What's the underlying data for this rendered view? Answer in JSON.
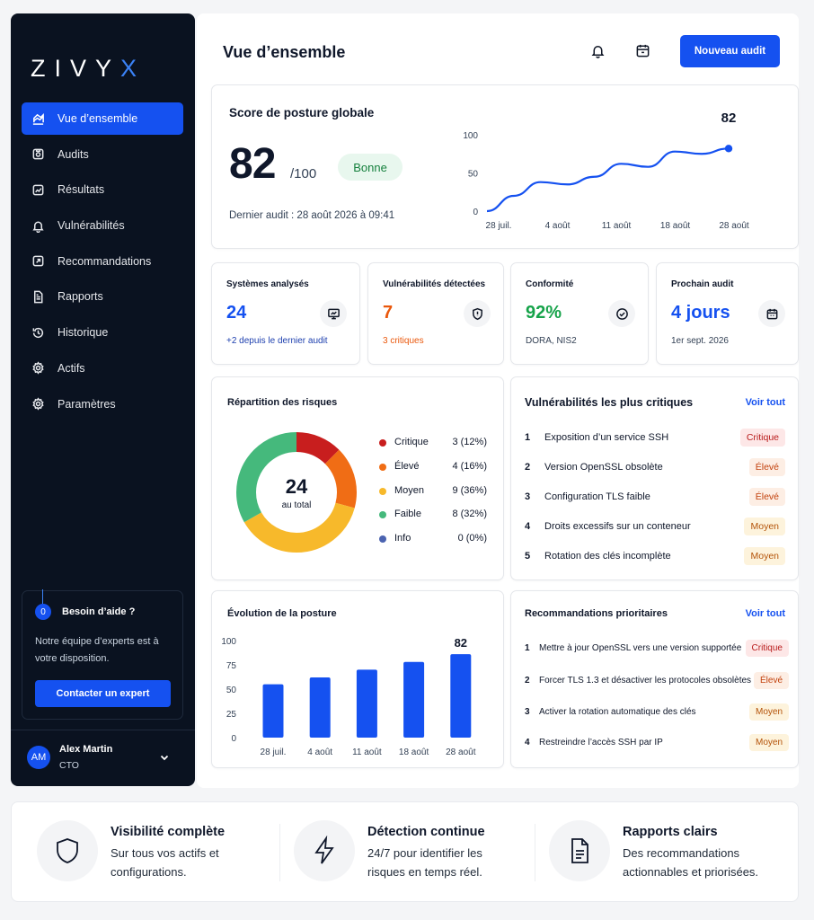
{
  "brand": {
    "logo_text": "ZIVY",
    "logo_accent": "X"
  },
  "sidebar": {
    "items": [
      {
        "label": "Vue d’ensemble",
        "icon": "overview-icon",
        "active": true
      },
      {
        "label": "Audits",
        "icon": "audit-icon"
      },
      {
        "label": "Résultats",
        "icon": "results-icon"
      },
      {
        "label": "Vulnérabilités",
        "icon": "bell-icon"
      },
      {
        "label": "Recommandations",
        "icon": "recommendations-icon"
      },
      {
        "label": "Rapports",
        "icon": "report-icon"
      },
      {
        "label": "Historique",
        "icon": "history-icon"
      },
      {
        "label": "Actifs",
        "icon": "assets-gear-icon"
      },
      {
        "label": "Paramètres",
        "icon": "settings-gear-icon"
      }
    ],
    "help": {
      "badge": "0",
      "title": "Besoin d’aide ?",
      "text": "Notre équipe d’experts est à votre disposition.",
      "button": "Contacter un expert"
    },
    "user": {
      "initials": "AM",
      "name": "Alex Martin",
      "role": "CTO"
    }
  },
  "header": {
    "title": "Vue d’ensemble",
    "new_audit_button": "Nouveau audit",
    "icons": [
      "bell-icon",
      "calendar-icon"
    ]
  },
  "score": {
    "title": "Score de posture globale",
    "value": "82",
    "max": "/100",
    "badge": "Bonne",
    "last_audit": "Dernier audit : 28 août 2026 à 09:41",
    "end_label": "82"
  },
  "kpis": [
    {
      "label": "Systèmes analysés",
      "value": "24",
      "sub": "+2 depuis le dernier audit",
      "value_color": "#1551f0",
      "sub_color": "#1e40af",
      "icon": "monitor-icon"
    },
    {
      "label": "Vulnérabilités détectées",
      "value": "7",
      "sub": "3 critiques",
      "value_color": "#ea580c",
      "sub_color": "#ea580c",
      "icon": "shield-alert-icon"
    },
    {
      "label": "Conformité",
      "value": "92%",
      "sub": "DORA, NIS2",
      "value_color": "#16a34a",
      "sub_color": "#334155",
      "icon": "check-circle-icon"
    },
    {
      "label": "Prochain audit",
      "value": "4 jours",
      "sub": "1er sept. 2026",
      "value_color": "#1551f0",
      "sub_color": "#334155",
      "icon": "calendar-icon"
    }
  ],
  "risks": {
    "title": "Répartition des risques",
    "total": "24",
    "total_label": "au total",
    "items": [
      {
        "label": "Critique",
        "value": "3 (12%)",
        "count": 3,
        "color": "#c81e1e"
      },
      {
        "label": "Élevé",
        "value": "4 (16%)",
        "count": 4,
        "color": "#f06d15"
      },
      {
        "label": "Moyen",
        "value": "9 (36%)",
        "count": 9,
        "color": "#f7b92b"
      },
      {
        "label": "Faible",
        "value": "8 (32%)",
        "count": 8,
        "color": "#45b97c"
      },
      {
        "label": "Info",
        "value": "0 (0%)",
        "count": 0,
        "color": "#4b63b0"
      }
    ]
  },
  "critical_vulns": {
    "title": "Vulnérabilités les plus critiques",
    "link": "Voir tout",
    "rows": [
      {
        "num": "1",
        "text": "Exposition d’un service SSH",
        "severity": "Critique",
        "level": "critique"
      },
      {
        "num": "2",
        "text": "Version OpenSSL obsolète",
        "severity": "Élevé",
        "level": "eleve"
      },
      {
        "num": "3",
        "text": "Configuration TLS faible",
        "severity": "Élevé",
        "level": "eleve"
      },
      {
        "num": "4",
        "text": "Droits excessifs sur un conteneur",
        "severity": "Moyen",
        "level": "moyen"
      },
      {
        "num": "5",
        "text": "Rotation des clés incomplète",
        "severity": "Moyen",
        "level": "moyen"
      }
    ]
  },
  "evolution": {
    "title": "Évolution de la posture"
  },
  "recommendations": {
    "title": "Recommandations prioritaires",
    "link": "Voir tout",
    "rows": [
      {
        "num": "1",
        "text": "Mettre à jour OpenSSL vers une version supportée",
        "severity": "Critique",
        "level": "critique"
      },
      {
        "num": "2",
        "text": "Forcer TLS 1.3 et désactiver les protocoles obsolètes",
        "severity": "Élevé",
        "level": "eleve"
      },
      {
        "num": "3",
        "text": "Activer la rotation automatique des clés",
        "severity": "Moyen",
        "level": "moyen"
      },
      {
        "num": "4",
        "text": "Restreindre l’accès SSH par IP",
        "severity": "Moyen",
        "level": "moyen"
      }
    ]
  },
  "features": [
    {
      "title": "Visibilité complète",
      "text": "Sur tous vos actifs et configurations.",
      "icon": "shield-icon"
    },
    {
      "title": "Détection continue",
      "text": "24/7 pour identifier les risques en temps réel.",
      "icon": "lightning-icon"
    },
    {
      "title": "Rapports clairs",
      "text": "Des recommandations actionnables et priorisées.",
      "icon": "document-icon"
    }
  ],
  "chart_data": [
    {
      "type": "line",
      "title": "Score de posture globale",
      "x": [
        "28 juil.",
        "4 août",
        "11 août",
        "18 août",
        "28 août"
      ],
      "x_ticks": [
        "28 juil.",
        "4 août",
        "11 août",
        "18 août",
        "28 août"
      ],
      "y": [
        0,
        20,
        38,
        35,
        45,
        62,
        58,
        78,
        75,
        82
      ],
      "ylim": [
        0,
        100
      ],
      "yticks": [
        0,
        50,
        100
      ],
      "end_label": "82",
      "color": "#1551f0"
    },
    {
      "type": "pie",
      "title": "Répartition des risques",
      "categories": [
        "Critique",
        "Élevé",
        "Moyen",
        "Faible",
        "Info"
      ],
      "values": [
        3,
        4,
        9,
        8,
        0
      ]
    },
    {
      "type": "bar",
      "title": "Évolution de la posture",
      "categories": [
        "28 juil.",
        "4 août",
        "11 août",
        "18 août",
        "28 août"
      ],
      "values": [
        55,
        62,
        70,
        78,
        86
      ],
      "ylim": [
        0,
        100
      ],
      "yticks": [
        0,
        25,
        50,
        75,
        100
      ],
      "last_label": "82",
      "color": "#1551f0"
    }
  ]
}
